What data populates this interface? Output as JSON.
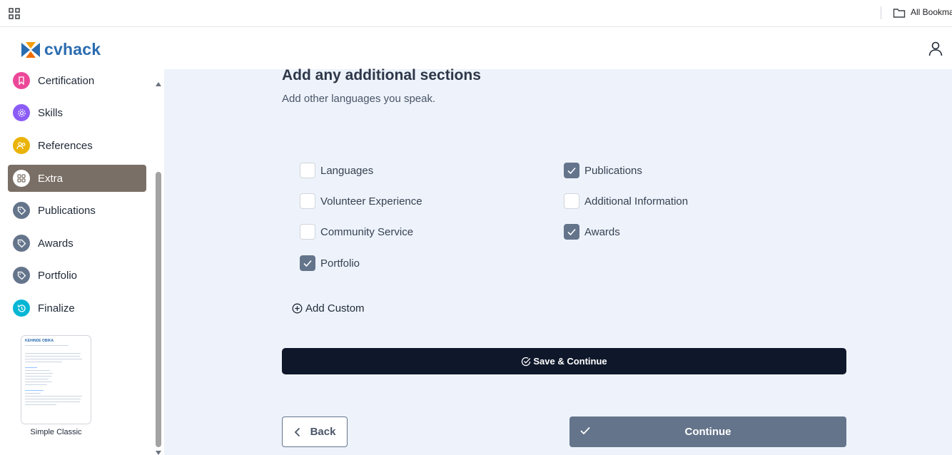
{
  "browser": {
    "bookmarks_label": "All Bookma",
    "apps_icon": "apps-grid-icon",
    "folder_icon": "folder-icon"
  },
  "header": {
    "brand": "cvhack",
    "brand_color": "#2b6cb0",
    "user_icon": "user-icon"
  },
  "sidebar": {
    "items": [
      {
        "label": "Certification",
        "icon": "award-badge-icon",
        "color": "#ec4899"
      },
      {
        "label": "Skills",
        "icon": "gear-icon",
        "color": "#8b5cf6"
      },
      {
        "label": "References",
        "icon": "people-icon",
        "color": "#eab308"
      },
      {
        "label": "Extra",
        "icon": "grid-icon",
        "color": "#ffffff",
        "active": true
      },
      {
        "label": "Publications",
        "icon": "tag-icon",
        "color": "#64748b"
      },
      {
        "label": "Awards",
        "icon": "tag-icon",
        "color": "#64748b"
      },
      {
        "label": "Portfolio",
        "icon": "tag-icon",
        "color": "#64748b"
      },
      {
        "label": "Finalize",
        "icon": "history-icon",
        "color": "#06b6d4"
      }
    ],
    "template": {
      "name": "KEHINDE OBIKA",
      "caption": "Simple Classic"
    },
    "active_color": "#7a6f66"
  },
  "main": {
    "title": "Add any additional sections",
    "subtitle": "Add other languages you speak.",
    "options": [
      {
        "label": "Languages",
        "checked": false
      },
      {
        "label": "Publications",
        "checked": true
      },
      {
        "label": "Volunteer Experience",
        "checked": false
      },
      {
        "label": "Additional Information",
        "checked": false
      },
      {
        "label": "Community Service",
        "checked": false
      },
      {
        "label": "Awards",
        "checked": true
      },
      {
        "label": "Portfolio",
        "checked": true
      }
    ],
    "add_custom_label": "Add Custom",
    "save_label": "Save & Continue",
    "back_label": "Back",
    "continue_label": "Continue"
  }
}
